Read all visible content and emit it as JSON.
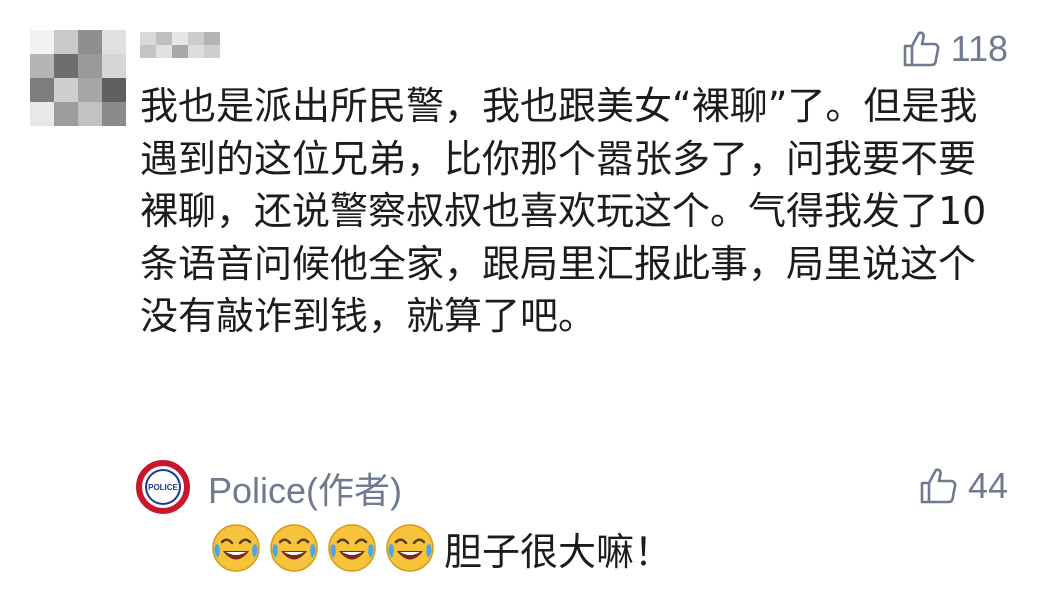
{
  "comment": {
    "like_icon": "thumbs-up-outline-icon",
    "like_count": "118",
    "text": "我也是派出所民警，我也跟美女“裸聊”了。但是我遇到的这位兄弟，比你那个嚣张多了，问我要不要裸聊，还说警察叔叔也喜欢玩这个。气得我发了10条语音问候他全家，跟局里汇报此事，局里说这个没有敲诈到钱，就算了吧。"
  },
  "reply": {
    "avatar_text": "POLICE",
    "author": "Police(作者)",
    "like_icon": "thumbs-up-outline-icon",
    "like_count": "44",
    "emoji_name": "laughing-crying-emoji",
    "emoji_count": 4,
    "text": "胆子很大嘛！"
  },
  "colors": {
    "text": "#1c1c1c",
    "meta": "#6f7a90",
    "police_red": "#c8162b",
    "police_blue": "#1b3a8c",
    "emoji_yellow": "#f6c33b"
  }
}
